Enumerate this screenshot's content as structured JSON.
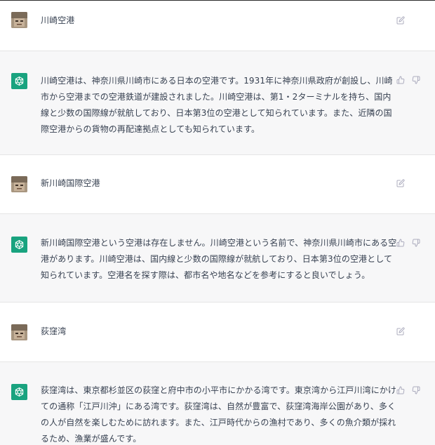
{
  "conversation": [
    {
      "role": "user",
      "text": "川崎空港"
    },
    {
      "role": "assistant",
      "text": "川崎空港は、神奈川県川崎市にある日本の空港です。1931年に神奈川県政府が創設し、川崎市から空港までの空港鉄道が建設されました。川崎空港は、第1・2ターミナルを持ち、国内線と少数の国際線が就航しており、日本第3位の空港として知られています。また、近隣の国際空港からの貨物の再配達拠点としても知られています。"
    },
    {
      "role": "user",
      "text": "新川崎国際空港"
    },
    {
      "role": "assistant",
      "text": "新川崎国際空港という空港は存在しません。川崎空港という名前で、神奈川県川崎市にある空港があります。川崎空港は、国内線と少数の国際線が就航しており、日本第3位の空港として知られています。空港名を探す際は、都市名や地名などを参考にすると良いでしょう。"
    },
    {
      "role": "user",
      "text": "荻窪湾"
    },
    {
      "role": "assistant",
      "text": "荻窪湾は、東京都杉並区の荻窪と府中市の小平市にかかる湾です。東京湾から江戸川湾にかけての通称「江戸川沖」にある湾です。荻窪湾は、自然が豊富で、荻窪湾海岸公園があり、多くの人が自然を楽しむために訪れます。また、江戸時代からの漁村であり、多くの魚介類が採れるため、漁業が盛んです。"
    }
  ],
  "icons": {
    "user_avatar": "user-avatar-photo",
    "assistant_avatar": "openai-logo-icon",
    "edit": "edit-icon",
    "thumbs_up": "thumbs-up-icon",
    "thumbs_down": "thumbs-down-icon"
  },
  "colors": {
    "assistant_bg": "#f7f7f8",
    "user_bg": "#ffffff",
    "logo_bg": "#19a37f",
    "text": "#374151",
    "icon": "#acacbe"
  }
}
